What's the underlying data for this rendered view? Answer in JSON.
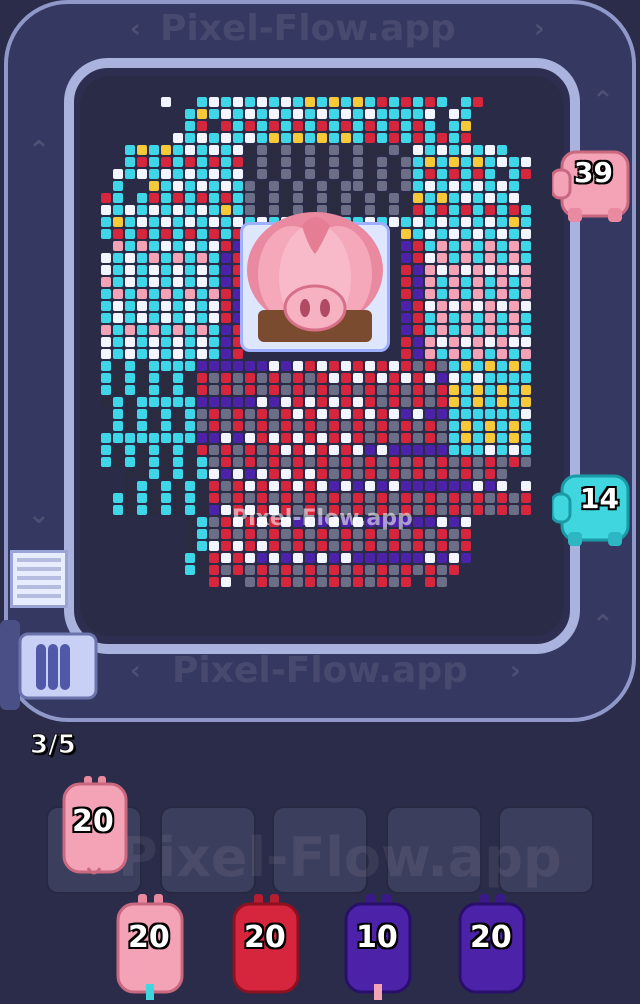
{
  "watermarks": {
    "top": "Pixel-Flow.app",
    "middle": "Pixel-Flow.app",
    "track_bottom": "Pixel-Flow.app",
    "slots": "Pixel-Flow.app"
  },
  "queue_counter": "3/5",
  "side_pigs": [
    {
      "count": "39",
      "color": "#f4a3b6"
    },
    {
      "count": "14",
      "color": "#3fd6e0"
    }
  ],
  "slot_pigs": [
    {
      "count": "20",
      "color": "#f4a3b6"
    }
  ],
  "empty_slots": 4,
  "queue_pigs": [
    {
      "count": "20",
      "color": "#f4a3b6"
    },
    {
      "count": "20",
      "color": "#d6263d"
    },
    {
      "count": "10",
      "color": "#4b22a8"
    },
    {
      "count": "20",
      "color": "#4b22a8"
    }
  ],
  "palette": {
    "cyan": "#3fd6e8",
    "white": "#f2f4ff",
    "yellow": "#f6c93b",
    "red": "#d6263d",
    "purple": "#4b22a8",
    "gray": "#6b6e86",
    "dark": "#2a2b3f",
    "pink": "#f4a3b6"
  }
}
